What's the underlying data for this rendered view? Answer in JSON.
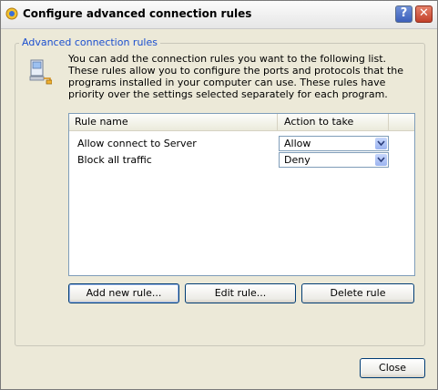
{
  "window": {
    "title": "Configure advanced connection rules",
    "help_label": "?",
    "close_label": "✕"
  },
  "group": {
    "label": "Advanced connection rules",
    "description": "You can add the connection rules you want to the following list. These rules allow you to configure the ports and protocols that the programs installed in your computer can use. These rules have priority over the settings selected separately for each program."
  },
  "rules_table": {
    "columns": [
      "Rule name",
      "Action to take"
    ],
    "rows": [
      {
        "name": "Allow connect to Server",
        "action": "Allow"
      },
      {
        "name": "Block all traffic",
        "action": "Deny"
      }
    ]
  },
  "buttons": {
    "add": "Add new rule...",
    "edit": "Edit rule...",
    "delete": "Delete rule",
    "close": "Close"
  },
  "colors": {
    "accent_label": "#1b4fcf",
    "dialog_bg": "#ece9d8"
  }
}
